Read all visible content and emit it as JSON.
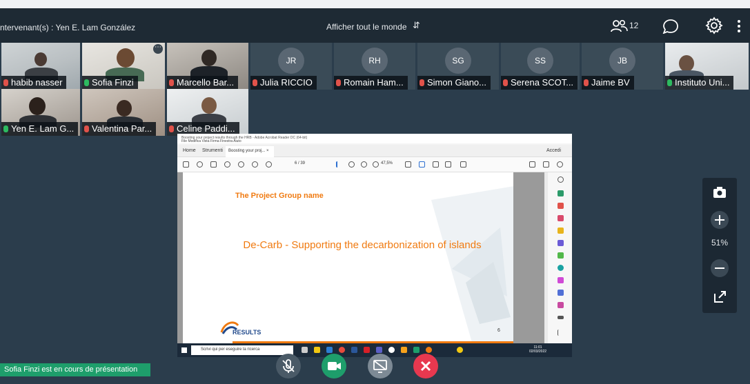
{
  "header": {
    "speaker_label": "ntervenant(s) : Yen E. Lam González",
    "show_all": "Afficher tout le monde",
    "participant_count": "12"
  },
  "participants": [
    {
      "name": "habib nasser",
      "initials": "",
      "mic": "off",
      "video": true
    },
    {
      "name": "Sofia Finzi",
      "initials": "",
      "mic": "on",
      "video": true
    },
    {
      "name": "Marcello Bar...",
      "initials": "",
      "mic": "off",
      "video": true
    },
    {
      "name": "Julia RICCIO",
      "initials": "JR",
      "mic": "off",
      "video": false
    },
    {
      "name": "Romain Ham...",
      "initials": "RH",
      "mic": "off",
      "video": false
    },
    {
      "name": "Simon Giano...",
      "initials": "SG",
      "mic": "off",
      "video": false
    },
    {
      "name": "Serena SCOT...",
      "initials": "SS",
      "mic": "off",
      "video": false
    },
    {
      "name": "Jaime BV",
      "initials": "JB",
      "mic": "off",
      "video": false
    },
    {
      "name": "Instituto Uni...",
      "initials": "",
      "mic": "on",
      "video": true
    },
    {
      "name": "Yen E. Lam G...",
      "initials": "",
      "mic": "on",
      "video": true
    },
    {
      "name": "Valentina Par...",
      "initials": "",
      "mic": "off",
      "video": true
    },
    {
      "name": "Celine Paddi...",
      "initials": "",
      "mic": "off",
      "video": true
    }
  ],
  "shared_screen": {
    "window_title": "Boosting your project results through the HRB - Adobe Acrobat Reader DC (64-bit)",
    "menu": "File  Modifica  Vista  Firma  Finestra  Aiuto",
    "tab_home": "Home",
    "tab_tools": "Strumenti",
    "tab_doc": "Boosting your proj...  ×",
    "accedi": "Accedi",
    "page_indicator": "6  / 39",
    "zoom": "47,5%",
    "slide_group_title": "The Project Group name",
    "slide_title": "De-Carb - Supporting the decarbonization of islands",
    "logo_text": "RESULTS",
    "page_number": "6",
    "taskbar_search": "Scrivi qui per eseguire la ricerca",
    "taskbar_time": "11:01",
    "taskbar_date": "02/03/2022"
  },
  "zoom_panel": {
    "value": "51%"
  },
  "status": {
    "text": "Sofia Finzi est en cours de présentation"
  },
  "colors": {
    "accent_orange": "#f07a10",
    "mic_off": "#e0524a",
    "mic_on": "#2dba60",
    "leave": "#e8384f",
    "video": "#1e9e6b"
  }
}
